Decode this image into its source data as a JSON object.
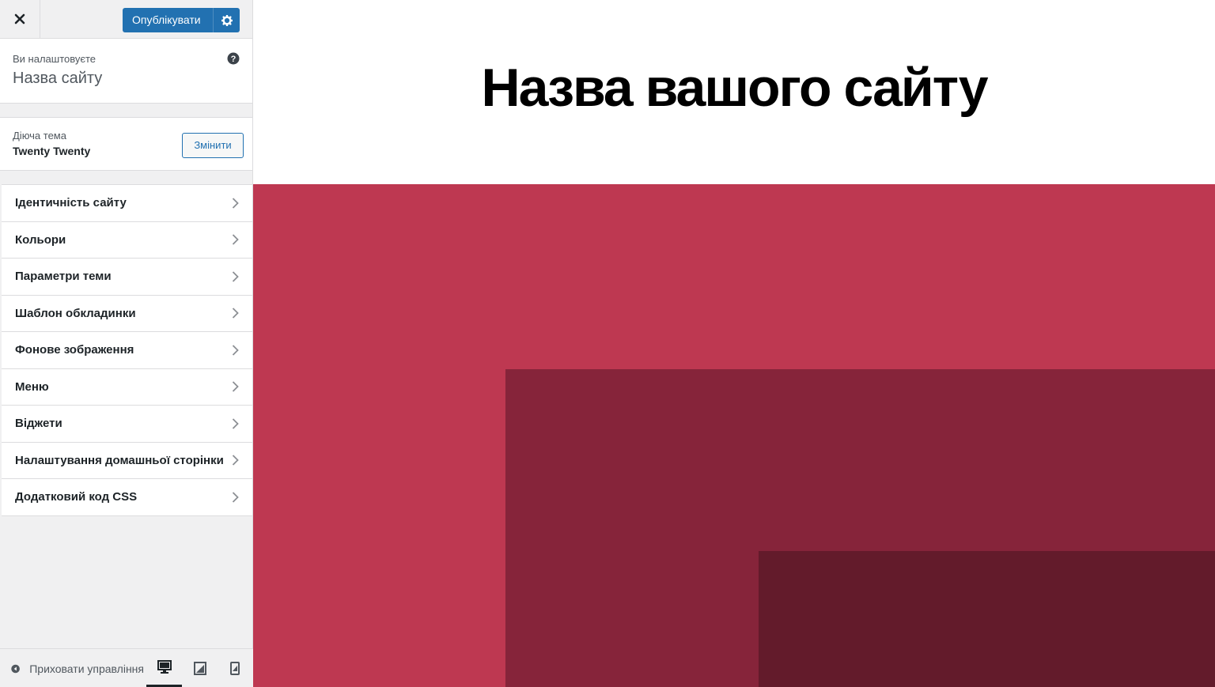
{
  "topbar": {
    "publish_label": "Опублікувати"
  },
  "info": {
    "small": "Ви налаштовуєте",
    "title": "Назва сайту"
  },
  "theme": {
    "small": "Діюча тема",
    "name": "Twenty Twenty",
    "change_label": "Змінити"
  },
  "menu": {
    "items": [
      {
        "label": "Ідентичність сайту"
      },
      {
        "label": "Кольори"
      },
      {
        "label": "Параметри теми"
      },
      {
        "label": "Шаблон обкладинки"
      },
      {
        "label": "Фонове зображення"
      },
      {
        "label": "Меню"
      },
      {
        "label": "Віджети"
      },
      {
        "label": "Налаштування домашньої сторінки"
      },
      {
        "label": "Додатковий код CSS"
      }
    ]
  },
  "footer": {
    "collapse_label": "Приховати управління"
  },
  "preview": {
    "site_title": "Назва вашого сайту"
  },
  "colors": {
    "accent": "#2271b1",
    "hero": "#be3851",
    "hero_dark": "#86243a",
    "hero_darker": "#631b2b"
  },
  "icons": {
    "close": "close-icon",
    "gear": "gear-icon",
    "help": "help-icon",
    "chevron": "chevron-right-icon",
    "collapse": "arrow-left-circle-icon",
    "desktop": "desktop-icon",
    "tablet": "tablet-icon",
    "mobile": "mobile-icon"
  }
}
